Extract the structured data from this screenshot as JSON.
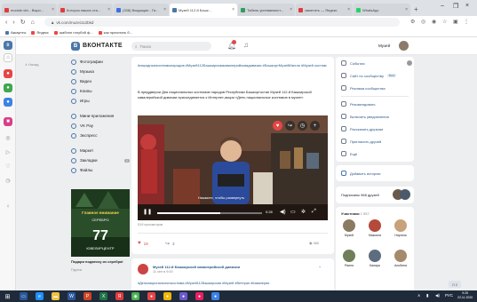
{
  "browser": {
    "tabs": [
      {
        "label": "module.vkv - Выро...",
        "color": "#e23b3b"
      },
      {
        "label": "Котороз наших ста...",
        "color": "#e23b3b"
      },
      {
        "label": "(338) Входящие - Ги...",
        "color": "#3b6fe2"
      },
      {
        "label": "Музей 112-й Башк...",
        "color": "#4a76a8"
      },
      {
        "label": "Табель успеваемост...",
        "color": "#2f9e5a"
      },
      {
        "label": "заметить — Яндекс",
        "color": "#e23b3b"
      },
      {
        "label": "WhatsApp",
        "color": "#25d366"
      }
    ],
    "active_tab": 3,
    "url": "vk.com/muzei112bkd",
    "bookmarks": [
      "Аккаунты",
      "Яндекс",
      "шаблон голубой ф...",
      "как прочитать б..."
    ]
  },
  "vk": {
    "logo_letter": "В",
    "brand": "ВКОНТАКТЕ",
    "search_placeholder": "Поиск",
    "account_name": "Музей",
    "back_link": "Назад"
  },
  "left_nav": {
    "items": [
      {
        "label": "Фотографии",
        "count": ""
      },
      {
        "label": "Музыка",
        "count": ""
      },
      {
        "label": "Видео",
        "count": ""
      },
      {
        "label": "Клипы",
        "count": ""
      },
      {
        "label": "Игры",
        "count": ""
      },
      {
        "label": "Мини-приложения",
        "count": ""
      },
      {
        "label": "VK Pay",
        "count": ""
      },
      {
        "label": "Экспресс",
        "count": ""
      },
      {
        "label": "Маркет",
        "count": ""
      },
      {
        "label": "Закладки",
        "count": "1"
      },
      {
        "label": "Файлы",
        "count": ""
      }
    ]
  },
  "ad": {
    "line1": "Главное внимание",
    "line2": "СЕРЕБРО",
    "number": "77",
    "line4": "ЮВЕЛИРЦЕНТР",
    "caption": "Подари подвеску из серебра!",
    "sub": "Пруток"
  },
  "post": {
    "tags": "#народныекостюмынародов #Музей112Башкирскаякавалерийскаядивизия #БашкортМузейМилли #Музей костюм",
    "text": "В преддверии Дня национальных костюмов народов Республики Башкортостан Музей 112-й Башкирской кавалерийской дивизии присоединяется к Интернет-акции «День национальных костюмов в музее».",
    "video_hint": "Нажмите, чтобы развернуть",
    "video_time": "0:28",
    "video_progress": 0.6,
    "views_text": "519 просмотров",
    "likes": "19",
    "shares": "3",
    "eye_count": "360"
  },
  "post2": {
    "title": "Музей 112-й Башкирской кавалерийской дивизии",
    "date": "11 сен в 9:00",
    "tags": "#Деньнациональногокостюма #Музей112Башкирская #Музей #Ветеран #Кавалерия"
  },
  "right_menu": {
    "items": [
      {
        "label": "События"
      },
      {
        "label": "Сайт по сообществу",
        "badge": "Beta"
      },
      {
        "label": "Реклама сообщества"
      },
      {
        "label": "Рекомендовать"
      },
      {
        "label": "Включить уведомления"
      },
      {
        "label": "Рассказать друзьям"
      },
      {
        "label": "Пригласить друзей"
      },
      {
        "label": "Ещё"
      }
    ],
    "add_story": "Добавить историю",
    "subscribed": "Подписаны 968 друзей",
    "members_title": "Участники",
    "members_count": "1 557",
    "members": [
      {
        "name": "Музей",
        "color": "#8b7a62"
      },
      {
        "name": "Максиля",
        "color": "#b34a3a"
      },
      {
        "name": "Наргиза",
        "color": "#c7a27a"
      },
      {
        "name": "Раиля",
        "color": "#6e7f5a"
      },
      {
        "name": "Капара",
        "color": "#5d6d80"
      },
      {
        "name": "Альбина",
        "color": "#a68a6e"
      }
    ]
  },
  "page_button": "Л 2",
  "taskbar": {
    "lang": "РУС",
    "time": "9:25",
    "date": "22.11.2020"
  }
}
